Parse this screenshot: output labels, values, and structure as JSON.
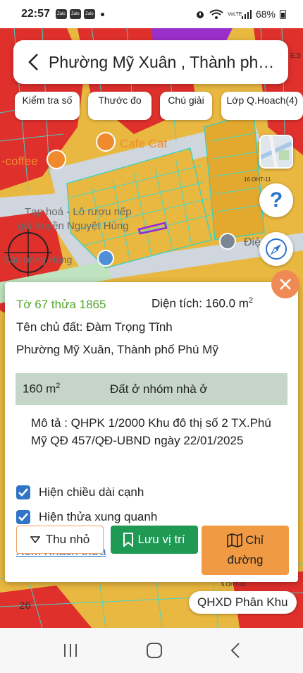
{
  "status": {
    "time": "22:57",
    "apps": [
      "Zalo",
      "Zalo",
      "Zalo"
    ],
    "network": "VoLTE",
    "battery": "68%"
  },
  "search": {
    "title": "Phường Mỹ Xuân , Thành phố Phú Mỹ"
  },
  "toolbar": {
    "check_label": "Kiểm tra số",
    "ruler_label": "Thước đo",
    "legend_label": "Chú giải",
    "layer_label": "Lớp Q.Hoach(4)"
  },
  "map_labels": {
    "cafe": "Cafe Cat",
    "coffee": "-coffee",
    "shop": "Tạp hoá - Lô rượu nếp",
    "shop2": "giả truyền Nguyệt Hùng",
    "place": "Sân bóng Hùng",
    "plot_code": "16.OHT-11",
    "plot_code2": "5.OHT-10",
    "dien": "Điện",
    "num": "26",
    "corner": "E.5"
  },
  "help_icon": "?",
  "panel": {
    "lot": "Tờ 67 thửa 1865",
    "area_label": "Diện tích: 160.0 m",
    "area_unit_sup": "2",
    "owner": "Tên chủ đất: Đàm Trọng Tĩnh",
    "address": "Phường Mỹ Xuân, Thành phố Phú Mỹ",
    "land_area": "160 m",
    "land_area_sup": "2",
    "land_type": "Đất ở nhóm nhà ở",
    "description": "Mô tả : QHPK 1/2000 Khu đô thị số 2 TX.Phú Mỹ QĐ 457/QĐ-UBND ngày 22/01/2025",
    "check_edges": "Hiện chiều dài cạnh",
    "check_neighbors": "Hiện thửa xung quanh",
    "view_neighbors": "Xem Khách thửa"
  },
  "actions": {
    "collapse": "Thu nhỏ",
    "save": "Lưu vị trí",
    "route_line1": "Chỉ",
    "route_line2": "đường"
  },
  "zone_label": "QHXD Phân Khu",
  "colors": {
    "residential": "#e9b840",
    "commercial": "#e0302c",
    "parcel_line": "#3fd8d0",
    "accent_green": "#1f9a55",
    "accent_orange": "#f19a44",
    "lot_green": "#55a630"
  }
}
